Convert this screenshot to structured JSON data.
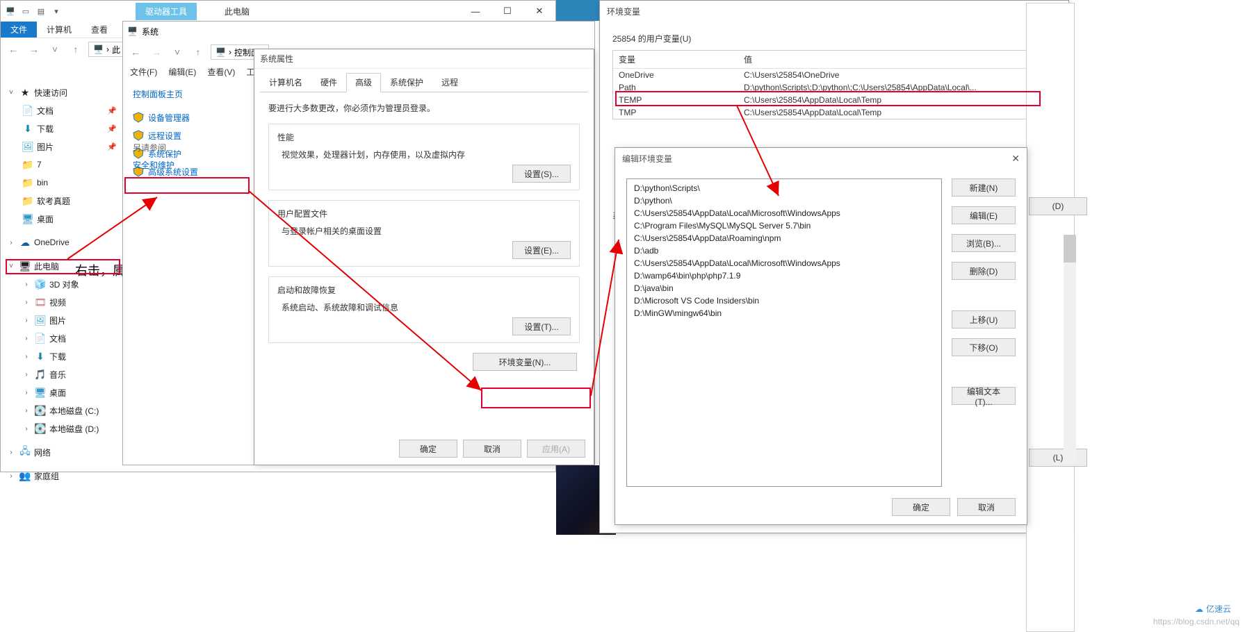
{
  "explorer": {
    "tools_tab": "驱动器工具",
    "title": "此电脑",
    "tabs": {
      "file": "文件",
      "computer": "计算机",
      "view": "查看"
    },
    "addr_prefix": "此"
  },
  "tree": {
    "quick_access": "快速访问",
    "documents": "文档",
    "downloads": "下载",
    "pictures": "图片",
    "seven": "7",
    "bin": "bin",
    "ruankao": "软考真题",
    "desktop": "桌面",
    "onedrive": "OneDrive",
    "this_pc": "此电脑",
    "3d": "3D 对象",
    "videos": "视频",
    "pictures2": "图片",
    "documents2": "文档",
    "downloads2": "下载",
    "music": "音乐",
    "desktop2": "桌面",
    "disk_c": "本地磁盘 (C:)",
    "disk_d": "本地磁盘 (D:)",
    "network": "网络",
    "homegroup": "家庭组"
  },
  "annotation": "右击，属性",
  "system_win": {
    "title": "系统",
    "breadcrumb": "控制面",
    "menu": {
      "file": "文件(F)",
      "edit": "编辑(E)",
      "view": "查看(V)",
      "tools": "工"
    },
    "cp_home": "控制面板主页",
    "links": {
      "devmgr": "设备管理器",
      "remote": "远程设置",
      "sysprotect": "系统保护",
      "advanced": "高级系统设置"
    },
    "see_also": "另请参阅",
    "security": "安全和维护"
  },
  "sysprop": {
    "title": "系统属性",
    "tabs": {
      "name": "计算机名",
      "hardware": "硬件",
      "advanced": "高级",
      "protect": "系统保护",
      "remote": "远程"
    },
    "need_admin": "要进行大多数更改，你必须作为管理员登录。",
    "perf": {
      "title": "性能",
      "desc": "视觉效果，处理器计划，内存使用，以及虚拟内存",
      "btn": "设置(S)..."
    },
    "profile": {
      "title": "用户配置文件",
      "desc": "与登录帐户相关的桌面设置",
      "btn": "设置(E)..."
    },
    "startup": {
      "title": "启动和故障恢复",
      "desc": "系统启动、系统故障和调试信息",
      "btn": "设置(T)..."
    },
    "env_btn": "环境变量(N)...",
    "ok": "确定",
    "cancel": "取消",
    "apply": "应用(A)"
  },
  "envvar": {
    "title": "环境变量",
    "user_label": "25854 的用户变量(U)",
    "col_var": "变量",
    "col_val": "值",
    "rows": [
      {
        "name": "OneDrive",
        "value": "C:\\Users\\25854\\OneDrive"
      },
      {
        "name": "Path",
        "value": "D:\\python\\Scripts\\;D:\\python\\;C:\\Users\\25854\\AppData\\Local\\..."
      },
      {
        "name": "TEMP",
        "value": "C:\\Users\\25854\\AppData\\Local\\Temp"
      },
      {
        "name": "TMP",
        "value": "C:\\Users\\25854\\AppData\\Local\\Temp"
      }
    ],
    "sys_label_partial": "系",
    "new": "新建(N)",
    "edit": "编辑(E)",
    "delete": "删除(D)",
    "ok": "确定",
    "cancel": "取消"
  },
  "editenv": {
    "title": "编辑环境变量",
    "items": [
      "D:\\python\\Scripts\\",
      "D:\\python\\",
      "C:\\Users\\25854\\AppData\\Local\\Microsoft\\WindowsApps",
      "C:\\Program Files\\MySQL\\MySQL Server 5.7\\bin",
      "C:\\Users\\25854\\AppData\\Roaming\\npm",
      "D:\\adb",
      "C:\\Users\\25854\\AppData\\Local\\Microsoft\\WindowsApps",
      "D:\\wamp64\\bin\\php\\php7.1.9",
      "D:\\java\\bin",
      "D:\\Microsoft VS Code Insiders\\bin",
      "D:\\MinGW\\mingw64\\bin"
    ],
    "btns": {
      "new": "新建(N)",
      "edit": "编辑(E)",
      "browse": "浏览(B)...",
      "delete": "删除(D)",
      "up": "上移(U)",
      "down": "下移(O)",
      "edit_text": "编辑文本(T)..."
    },
    "ok": "确定",
    "cancel": "取消"
  },
  "right_btns": {
    "d1": "(D)",
    "l": "(L)"
  },
  "watermark": "https://blog.csdn.net/qq",
  "yisu": "亿速云"
}
